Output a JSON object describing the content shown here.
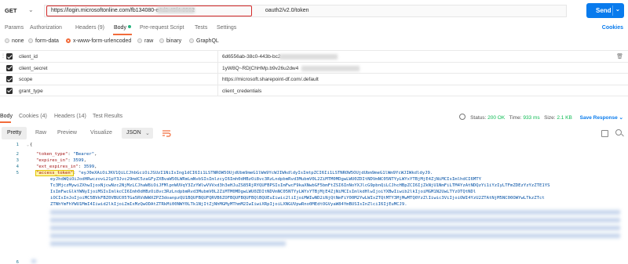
{
  "request": {
    "method": "GET",
    "url": "https://login.microsoftonline.com/fb134080-e4d2-45f4-9562",
    "url_suffix": "oauth2/v2.0/token",
    "send_label": "Send"
  },
  "request_tabs": [
    "Params",
    "Authorization",
    "Headers (9)",
    "Body",
    "Pre-request Script",
    "Tests",
    "Settings"
  ],
  "cookies_label": "Cookies",
  "body_types": [
    "none",
    "form-data",
    "x-www-form-urlencoded",
    "raw",
    "binary",
    "GraphQL"
  ],
  "selected_body_type": "x-www-form-urlencoded",
  "params": [
    {
      "key": "client_id",
      "value": "6d6556ab-38c0-443b-bc2"
    },
    {
      "key": "client_secret",
      "value": "1yW8Q~RD|ChHMp.b9v26u2dw4"
    },
    {
      "key": "scope",
      "value": "https://microsoft.sharepoint-df.com/.default"
    },
    {
      "key": "grant_type",
      "value": "client_credentials"
    }
  ],
  "response_tabs": [
    "Body",
    "Cookies (4)",
    "Headers (14)",
    "Test Results"
  ],
  "response_status": {
    "status_label": "Status:",
    "status": "200 OK",
    "time_label": "Time:",
    "time": "933 ms",
    "size_label": "Size:",
    "size": "2.1 KB",
    "save_label": "Save Response"
  },
  "format_tabs": [
    "Pretty",
    "Raw",
    "Preview",
    "Visualize"
  ],
  "format_select": "JSON",
  "json": {
    "token_type_key": "\"token_type\"",
    "token_type_val": "\"Bearer\"",
    "expires_in_key": "\"expires_in\"",
    "expires_in_val": "3599",
    "ext_expires_in_key": "\"ext_expires_in\"",
    "ext_expires_in_val": "3599",
    "access_token_key": "\"access_token\"",
    "access_token_lines": [
      "\"eyJ0eXAiOiJKV1QiLCJhbGciOiJSUzI1NiIsIng1dCI6Ii1LSTNROW5OUjdUbm9meG1lWm9YcWJIWkdldyIsImtpZCI6Ii1LSTNROW5OUjdUbm9meG1lWm9YcWJIWkdldyJ9.",
      "eyJhdWQiOiJodHRwczovL21pY3Jvc29mdC5zaGFyZXBvaW50LWRmLmNvbSIsImlzcyI6Imh0dHBzOi8vc3RzLndpbmRvd3MubmV0L2ZiMTM0MDgwLWU0ZDItNDVmNC05NTYyLWYxYTBjMjE4ZjNiMCIsImlhdCI6MTY",
      "Tc3MjczMywiZXhwIjoxNjcwNzc2NjMzLCJhaW8iOiJFMlpnWUVqY3ZzYWlwVVVxd3h3eHJuZS85RjRYQUFBPSIsImFwcF9kaXNwbGF5bmFtZSI6InNoYXJlcG9pbnQiLCJhcHBpZCI6IjZkNjU1NmFiLTM4YzAtNDQzYi1iYzIyLTFmZDEzYzYzZTE1YS",
      "IsImFwcGlkYWNyIjoiMSIsImlkcCI6Imh0dHBzOi8vc3RzLndpbmRvd3MubmV0L2ZiMTM0MDgwLWU0ZDItNDVmNC05NTYyLWYxYTBjMjE4ZjNiMCIsImlkdHlwIjoiYXBwIiwib2lkIjoiMGM1N2UwLTYzOTQtNDl",
      "iOCIsInJoIjoiMC5BVkFBZ0VBUC05TGa5RVdWWXZPZ3doanpzQU1BQUFBQUFQRVB6ZOFBQUFBQUFBQlBQUEuIiwic2liIjoiMWIwND2iNjQtNmFiY00M2YwLWIxZTQtMTY3MjMwMTQ0YzZlIiwic3ViIjoiOWI4YzU2ZTAtNjM5NC00OWYwLTkzZTct",
      "ZTNhYmFhYWU1MmI4Iiwid2lkIjoiZmIxMzQwODAtZTRkMi00NWY0LTk1NjItZjNhMGMyMThmM2IwIiwiXRpIjoiLXNGUVpwRno0MEdtOGVyaW84YmBUSIsInZlciI6IjEuMCJ9."
    ]
  }
}
